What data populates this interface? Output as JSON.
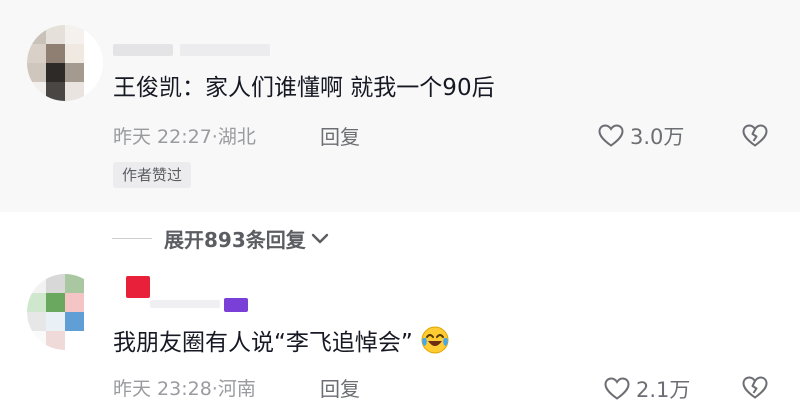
{
  "comments": [
    {
      "text": "王俊凯：家人们谁懂啊 就我一个90后",
      "time_location": "昨天 22:27·湖北",
      "reply_label": "回复",
      "like_count": "3.0万",
      "badge": "作者赞过",
      "avatar_colors": [
        "#c9c2b8",
        "#e6e0da",
        "#f4f1ee",
        "#ffffff",
        "#d9d1c8",
        "#8f7f73",
        "#efe9e2",
        "#ffffff",
        "#cfc7bd",
        "#2e2a28",
        "#a59a90",
        "#ffffff",
        "#f2efec",
        "#4a4644",
        "#e9e4df",
        "#ffffff"
      ]
    },
    {
      "text": "我朋友圈有人说“李飞追悼会”",
      "time_location": "昨天 23:28·河南",
      "reply_label": "回复",
      "like_count": "2.1万",
      "avatar_colors": [
        "#f2f2f2",
        "#d8d8d8",
        "#a9c7a0",
        "#ffffff",
        "#cfe7cc",
        "#6aa85f",
        "#f5c4c4",
        "#ffffff",
        "#e7e7e7",
        "#e9f1f7",
        "#5f9fd6",
        "#ffffff",
        "#fafafa",
        "#f0d9d9",
        "#ffffff",
        "#ffffff"
      ]
    }
  ],
  "expand": {
    "label": "展开893条回复"
  },
  "icons": {
    "like": "heart-outline-icon",
    "dislike": "broken-heart-icon",
    "chevron": "chevron-down-icon",
    "emoji": "crying-laughing-emoji"
  },
  "colors": {
    "text": "#161823",
    "meta": "#9a9b9f",
    "pinned_bg": "#f8f8f8"
  }
}
